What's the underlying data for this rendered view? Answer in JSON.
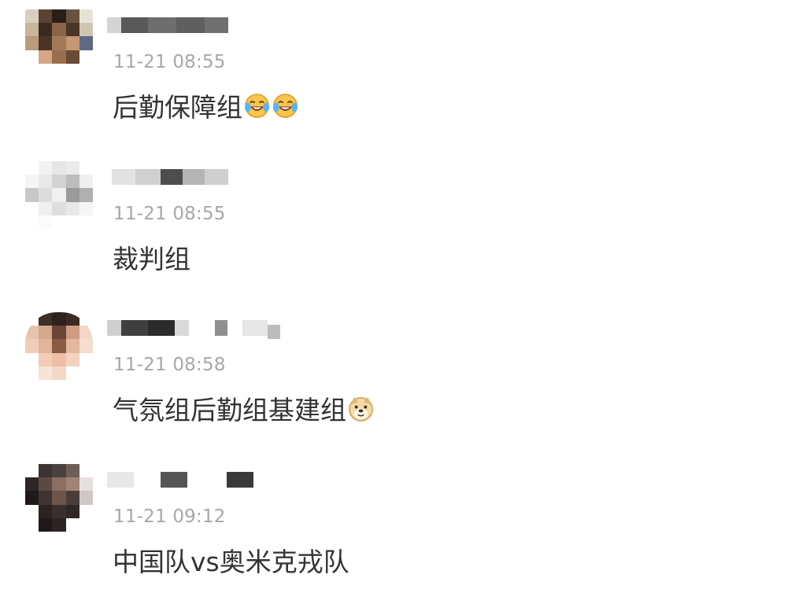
{
  "comments": [
    {
      "username": "",
      "time": "11-21 08:55",
      "text": "后勤保障组",
      "emoji": [
        "laughing-crying-emoji",
        "laughing-crying-emoji"
      ]
    },
    {
      "username": "",
      "time": "11-21 08:55",
      "text": "裁判组",
      "emoji": []
    },
    {
      "username": "",
      "time": "11-21 08:58",
      "text": "气氛组后勤组基建组",
      "emoji": [
        "doge-emoji"
      ]
    },
    {
      "username": "",
      "time": "11-21 09:12",
      "text": "中国队vs奥米克戎队",
      "emoji": []
    }
  ],
  "colors": {
    "timestamp": "#a7a7a7",
    "text": "#333333",
    "background": "#ffffff"
  }
}
